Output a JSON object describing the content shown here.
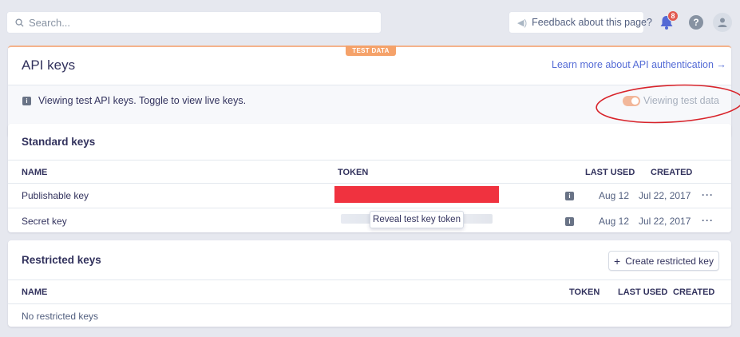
{
  "topbar": {
    "search_placeholder": "Search...",
    "feedback_label": "Feedback about this page?",
    "notification_count": "8",
    "help_label": "?"
  },
  "api_keys": {
    "badge": "TEST DATA",
    "title": "API keys",
    "learn_more": "Learn more about API authentication →",
    "info_text": "Viewing test API keys. Toggle to view live keys.",
    "toggle_label": "Viewing test data"
  },
  "standard_keys": {
    "title": "Standard keys",
    "columns": {
      "name": "NAME",
      "token": "TOKEN",
      "last_used": "LAST USED",
      "created": "CREATED"
    },
    "rows": [
      {
        "name": "Publishable key",
        "last_used": "Aug 12",
        "created": "Jul 22, 2017",
        "more": "···"
      },
      {
        "name": "Secret key",
        "last_used": "Aug 12",
        "created": "Jul 22, 2017",
        "more": "···"
      }
    ],
    "tooltip": "Reveal test key token"
  },
  "restricted_keys": {
    "title": "Restricted keys",
    "create_button": "Create restricted key",
    "columns": {
      "name": "NAME",
      "token": "TOKEN",
      "last_used": "LAST USED",
      "created": "CREATED"
    },
    "empty_text": "No restricted keys"
  },
  "colors": {
    "accent": "#556cd6",
    "test_badge": "#f5a26a",
    "annotation": "#d8232a",
    "redaction": "#f0323f"
  }
}
